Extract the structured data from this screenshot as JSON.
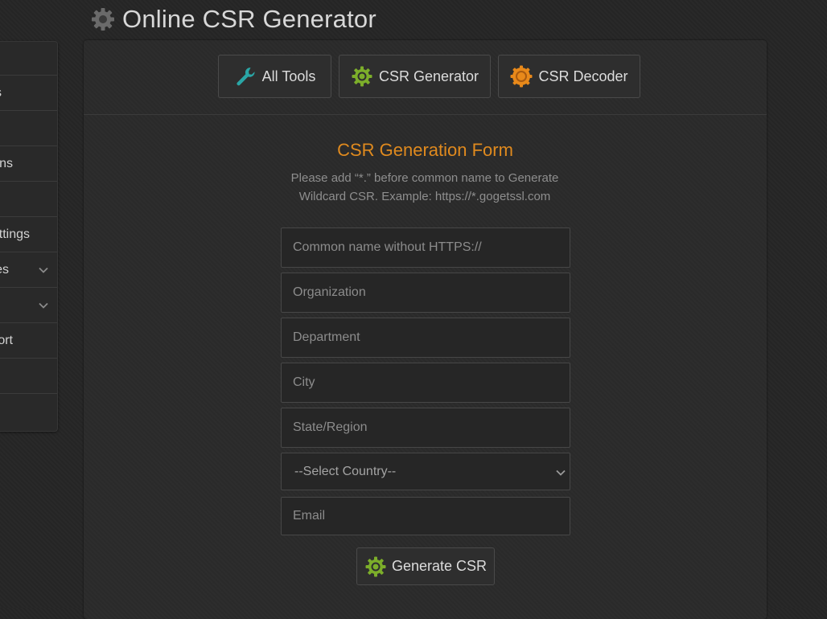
{
  "page": {
    "title": "Online CSR Generator"
  },
  "sidebar": {
    "items": [
      {
        "label": ""
      },
      {
        "label": "s"
      },
      {
        "label": ""
      },
      {
        "label": "ns"
      },
      {
        "label": ""
      },
      {
        "label": "ttings"
      },
      {
        "label": "es"
      },
      {
        "label": ""
      },
      {
        "label": "ort"
      },
      {
        "label": ""
      },
      {
        "label": ""
      }
    ]
  },
  "toolbar": {
    "all_tools": "All Tools",
    "csr_generator": "CSR Generator",
    "csr_decoder": "CSR Decoder"
  },
  "form": {
    "title": "CSR Generation Form",
    "description_line1": "Please add “*.” before common name to Generate",
    "description_line2": "Wildcard CSR. Example: https://*.gogetssl.com",
    "common_name_placeholder": "Common name without HTTPS://",
    "organization_placeholder": "Organization",
    "department_placeholder": "Department",
    "city_placeholder": "City",
    "state_placeholder": "State/Region",
    "country_selected": "--Select Country--",
    "email_placeholder": "Email",
    "submit_label": "Generate CSR"
  },
  "colors": {
    "accent_orange": "#e08a1e",
    "gear_green": "#7cae2a",
    "wrench_teal": "#2aa6a6",
    "decoder_orange": "#e8891a"
  }
}
